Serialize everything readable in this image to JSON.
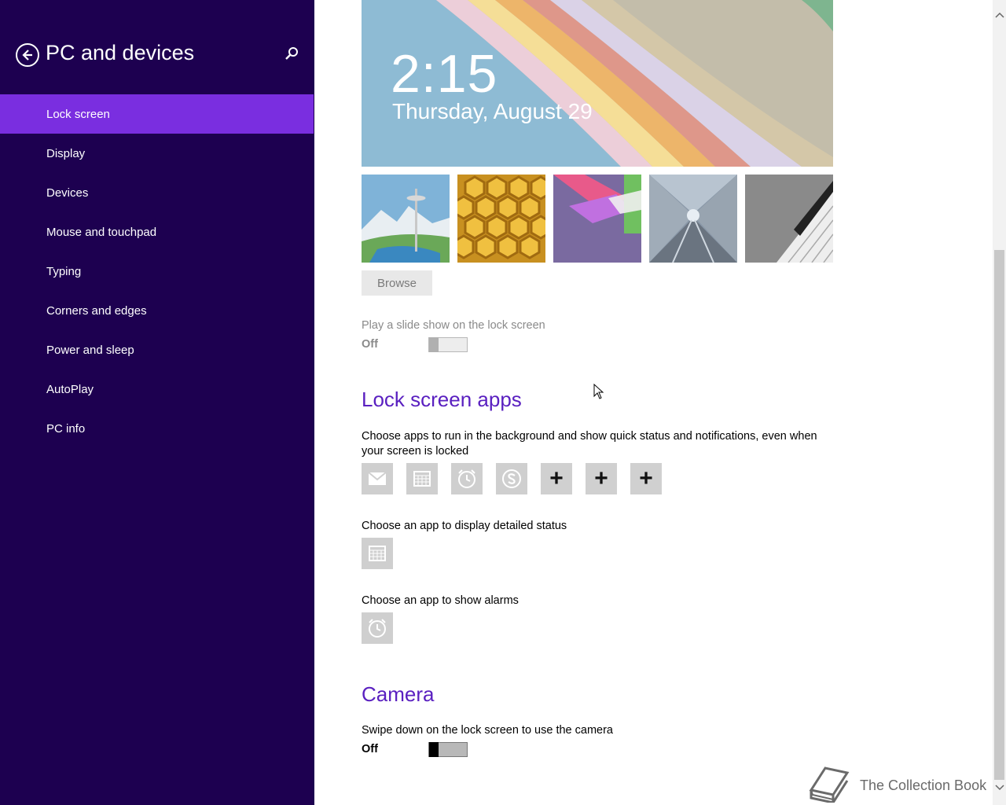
{
  "sidebar": {
    "title": "PC and devices",
    "back_icon": "back-arrow-icon",
    "search_icon": "search-icon",
    "items": [
      {
        "label": "Lock screen",
        "active": true
      },
      {
        "label": "Display"
      },
      {
        "label": "Devices"
      },
      {
        "label": "Mouse and touchpad"
      },
      {
        "label": "Typing"
      },
      {
        "label": "Corners and edges"
      },
      {
        "label": "Power and sleep"
      },
      {
        "label": "AutoPlay"
      },
      {
        "label": "PC info"
      }
    ]
  },
  "preview": {
    "time": "2:15",
    "date": "Thursday, August 29"
  },
  "thumbnails": [
    "space-needle",
    "honeycomb",
    "geometric-shapes",
    "tunnel",
    "piano-keys"
  ],
  "browse_label": "Browse",
  "slideshow": {
    "label": "Play a slide show on the lock screen",
    "state": "Off"
  },
  "lock_screen_apps": {
    "heading": "Lock screen apps",
    "description": "Choose apps to run in the background and show quick status and notifications, even when your screen is locked",
    "apps": [
      "mail-icon",
      "calendar-icon",
      "alarm-icon",
      "skype-icon",
      "plus-icon",
      "plus-icon",
      "plus-icon"
    ],
    "plus_glyph": "+",
    "detailed_status_label": "Choose an app to display detailed status",
    "detailed_status_app": "calendar-icon",
    "alarms_label": "Choose an app to show alarms",
    "alarms_app": "alarm-icon"
  },
  "camera": {
    "heading": "Camera",
    "label": "Swipe down on the lock screen to use the camera",
    "state": "Off"
  },
  "watermark": {
    "text": "The Collection Book",
    "icon": "book-icon"
  },
  "colors": {
    "sidebar_bg": "#1d0050",
    "active_item": "#7a2ee0",
    "heading": "#5a20c0"
  }
}
